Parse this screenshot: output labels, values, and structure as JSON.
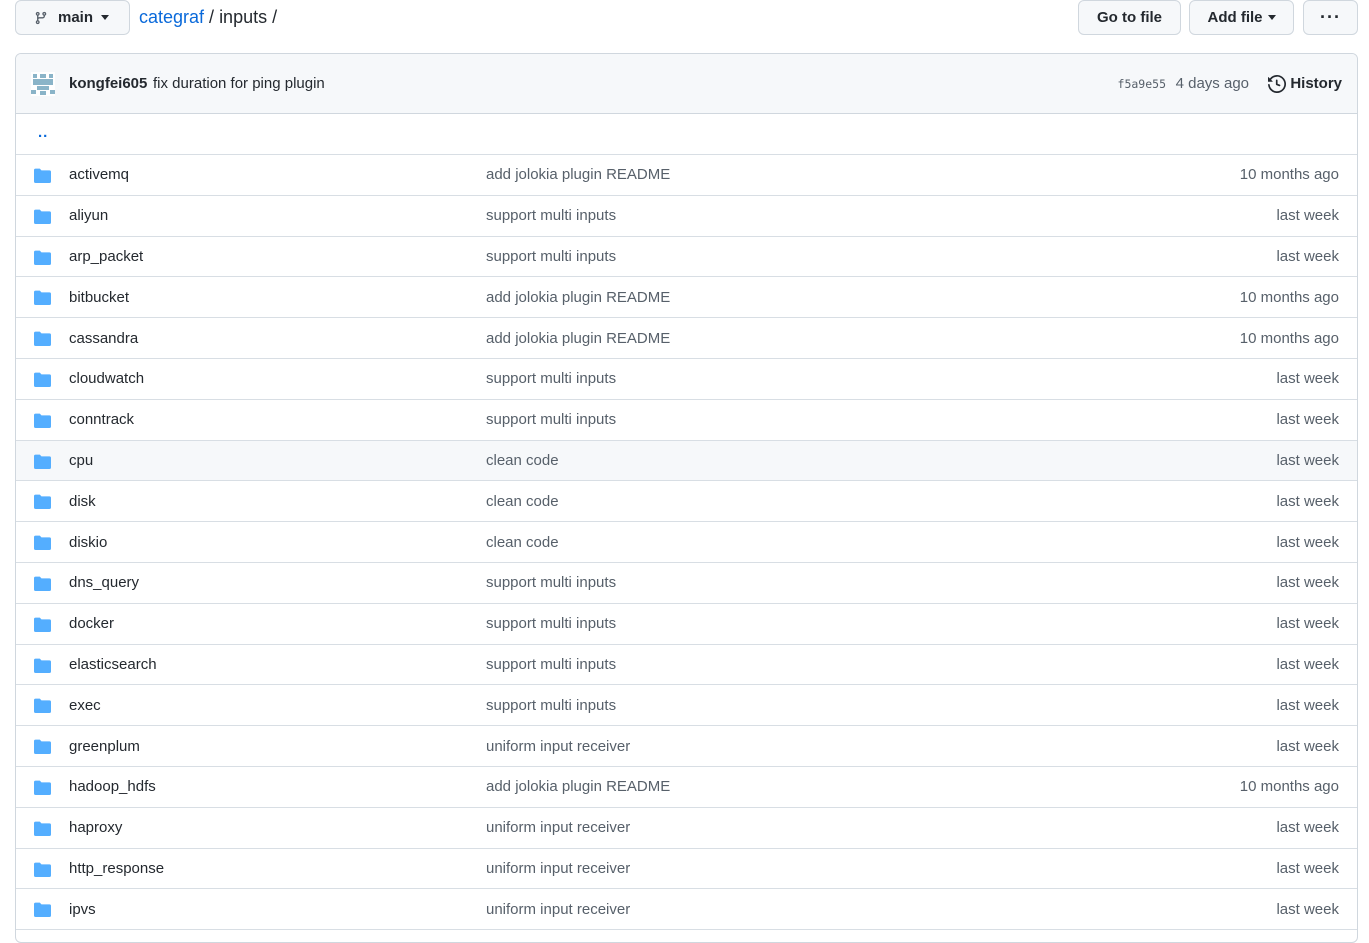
{
  "header": {
    "branch": "main",
    "repo": "categraf",
    "path_sep": "/",
    "current_dir": "inputs",
    "trailing_sep": "/",
    "go_to_file": "Go to file",
    "add_file": "Add file",
    "more": "···"
  },
  "commit": {
    "author": "kongfei605",
    "message": "fix duration for ping plugin",
    "sha": "f5a9e55",
    "age": "4 days ago",
    "history": "History"
  },
  "parent_link": "..",
  "files": [
    {
      "name": "activemq",
      "message": "add jolokia plugin README",
      "age": "10 months ago"
    },
    {
      "name": "aliyun",
      "message": "support multi inputs",
      "age": "last week"
    },
    {
      "name": "arp_packet",
      "message": "support multi inputs",
      "age": "last week"
    },
    {
      "name": "bitbucket",
      "message": "add jolokia plugin README",
      "age": "10 months ago"
    },
    {
      "name": "cassandra",
      "message": "add jolokia plugin README",
      "age": "10 months ago"
    },
    {
      "name": "cloudwatch",
      "message": "support multi inputs",
      "age": "last week"
    },
    {
      "name": "conntrack",
      "message": "support multi inputs",
      "age": "last week"
    },
    {
      "name": "cpu",
      "message": "clean code",
      "age": "last week"
    },
    {
      "name": "disk",
      "message": "clean code",
      "age": "last week"
    },
    {
      "name": "diskio",
      "message": "clean code",
      "age": "last week"
    },
    {
      "name": "dns_query",
      "message": "support multi inputs",
      "age": "last week"
    },
    {
      "name": "docker",
      "message": "support multi inputs",
      "age": "last week"
    },
    {
      "name": "elasticsearch",
      "message": "support multi inputs",
      "age": "last week"
    },
    {
      "name": "exec",
      "message": "support multi inputs",
      "age": "last week"
    },
    {
      "name": "greenplum",
      "message": "uniform input receiver",
      "age": "last week"
    },
    {
      "name": "hadoop_hdfs",
      "message": "add jolokia plugin README",
      "age": "10 months ago"
    },
    {
      "name": "haproxy",
      "message": "uniform input receiver",
      "age": "last week"
    },
    {
      "name": "http_response",
      "message": "uniform input receiver",
      "age": "last week"
    },
    {
      "name": "ipvs",
      "message": "uniform input receiver",
      "age": "last week"
    }
  ],
  "highlighted_row": "cpu",
  "colors": {
    "link": "#0969da",
    "folder": "#54aeff",
    "muted": "#57606a",
    "header_bg": "#f6f8fa",
    "border": "#d0d7de"
  }
}
